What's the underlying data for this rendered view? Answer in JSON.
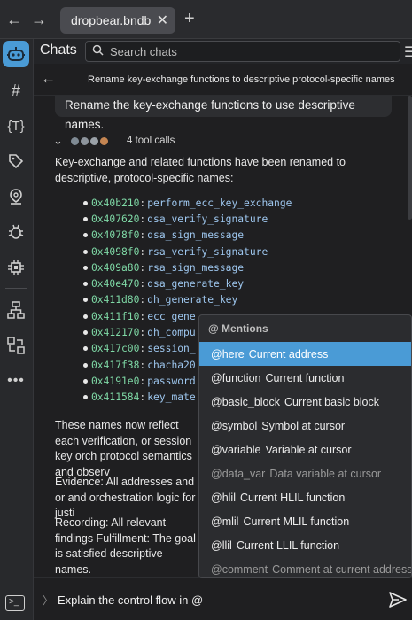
{
  "browser": {
    "back_icon": "←",
    "forward_icon": "→",
    "tab_title": "dropbear.bndb",
    "tab_close": "✕",
    "new_tab": "+"
  },
  "header": {
    "title": "Chats",
    "search_placeholder": "Search chats",
    "menu_icon": "☰"
  },
  "conversation": {
    "title": "Rename key-exchange functions to descriptive protocol-specific names",
    "user_message": "Rename the key-exchange functions to use descriptive names.",
    "tool_calls_label": "4 tool calls",
    "tool_dot_colors": [
      "#7f8a94",
      "#8d949c",
      "#9aa1a8",
      "#c48552"
    ],
    "intro": "Key-exchange and related functions have been renamed to descriptive, protocol-specific names:",
    "renamed": [
      {
        "addr": "0x40b210",
        "name": "perform_ecc_key_exchange"
      },
      {
        "addr": "0x407620",
        "name": "dsa_verify_signature"
      },
      {
        "addr": "0x4078f0",
        "name": "dsa_sign_message"
      },
      {
        "addr": "0x4098f0",
        "name": "rsa_verify_signature"
      },
      {
        "addr": "0x409a80",
        "name": "rsa_sign_message"
      },
      {
        "addr": "0x40e470",
        "name": "dsa_generate_key"
      },
      {
        "addr": "0x411d80",
        "name": "dh_generate_key"
      },
      {
        "addr": "0x411f10",
        "name": "ecc_gene"
      },
      {
        "addr": "0x412170",
        "name": "dh_compu"
      },
      {
        "addr": "0x417c00",
        "name": "session_"
      },
      {
        "addr": "0x417f38",
        "name": "chacha20"
      },
      {
        "addr": "0x4191e0",
        "name": "password"
      },
      {
        "addr": "0x411584",
        "name": "key_mate"
      }
    ],
    "summary": "These names now reflect each verification, or session key orch protocol semantics and observ",
    "evidence": "Evidence: All addresses and or and orchestration logic for justi",
    "recording": "Recording: All relevant findings Fulfillment: The goal is satisfied descriptive names."
  },
  "composer": {
    "chevron": "〉",
    "value": "Explain the control flow in @"
  },
  "mentions": {
    "header": "@ Mentions",
    "items": [
      {
        "name": "@here",
        "desc": "Current address"
      },
      {
        "name": "@function",
        "desc": "Current function"
      },
      {
        "name": "@basic_block",
        "desc": "Current basic block"
      },
      {
        "name": "@symbol",
        "desc": "Symbol at cursor"
      },
      {
        "name": "@variable",
        "desc": "Variable at cursor"
      },
      {
        "name": "@data_var",
        "desc": "Data variable at cursor"
      },
      {
        "name": "@hlil",
        "desc": "Current HLIL function"
      },
      {
        "name": "@mlil",
        "desc": "Current MLIL function"
      },
      {
        "name": "@llil",
        "desc": "Current LLIL function"
      },
      {
        "name": "@comment",
        "desc": "Comment at current address"
      }
    ]
  },
  "sidebar_icons": [
    "assistant-robot-icon",
    "hash-icon",
    "type-braces-icon",
    "tag-icon",
    "location-pin-icon",
    "bug-icon",
    "chip-icon",
    "hierarchy-icon",
    "grid-arrows-icon",
    "more-icon",
    "terminal-icon"
  ],
  "colors": {
    "accent": "#4a9bd6",
    "address": "#7fd9a6",
    "function_name": "#9ec7ef"
  }
}
